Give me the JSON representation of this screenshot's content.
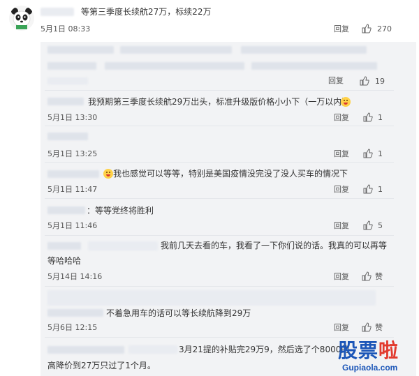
{
  "main_comment": {
    "text": "等第三季度长续航27万，标续22万",
    "time": "5月1日 08:33",
    "reply_label": "回复",
    "likes": "270"
  },
  "replies": [
    {
      "text": "",
      "time": "",
      "reply_label": "回复",
      "likes": "19"
    },
    {
      "text": "我预期第三季度长续航29万出头，标准升级版价格小小下（一万以内）",
      "time": "5月1日 13:30",
      "reply_label": "回复",
      "likes": "1"
    },
    {
      "text": "",
      "time": "5月1日 13:25",
      "reply_label": "回复",
      "likes": "1"
    },
    {
      "text": "我也感觉可以等等，特别是美国疫情没完没了没人买车的情况下",
      "time": "5月1日 11:47",
      "reply_label": "回复",
      "likes": "1"
    },
    {
      "text": "：等等党终将胜利",
      "time": "5月1日 11:46",
      "reply_label": "回复",
      "likes": "5"
    },
    {
      "text": "我前几天去看的车，我看了一下你们说的话。我真的可以再等",
      "text2": "等哈哈哈",
      "time": "5月14日 14:16",
      "reply_label": "回复",
      "likes": "赞"
    },
    {
      "text": "不着急用车的话可以等长续航降到29万",
      "time": "5月6日 12:15",
      "reply_label": "回复",
      "likes": "赞"
    },
    {
      "text": "3月21提的补贴完29万9，然后选了个8000的",
      "text2": "高降价到27万只过了1个月。"
    }
  ],
  "watermark": {
    "cn1": "股票",
    "cn2": "啦",
    "url": "Gupiaola.com"
  },
  "colors": {
    "thread_bg": "#f2f3f5",
    "watermark_blue": "#1c56b8",
    "watermark_red": "#e23a2e"
  },
  "icons": [
    "panda-avatar-icon",
    "thumbs-up-icon",
    "emoji-icon"
  ]
}
